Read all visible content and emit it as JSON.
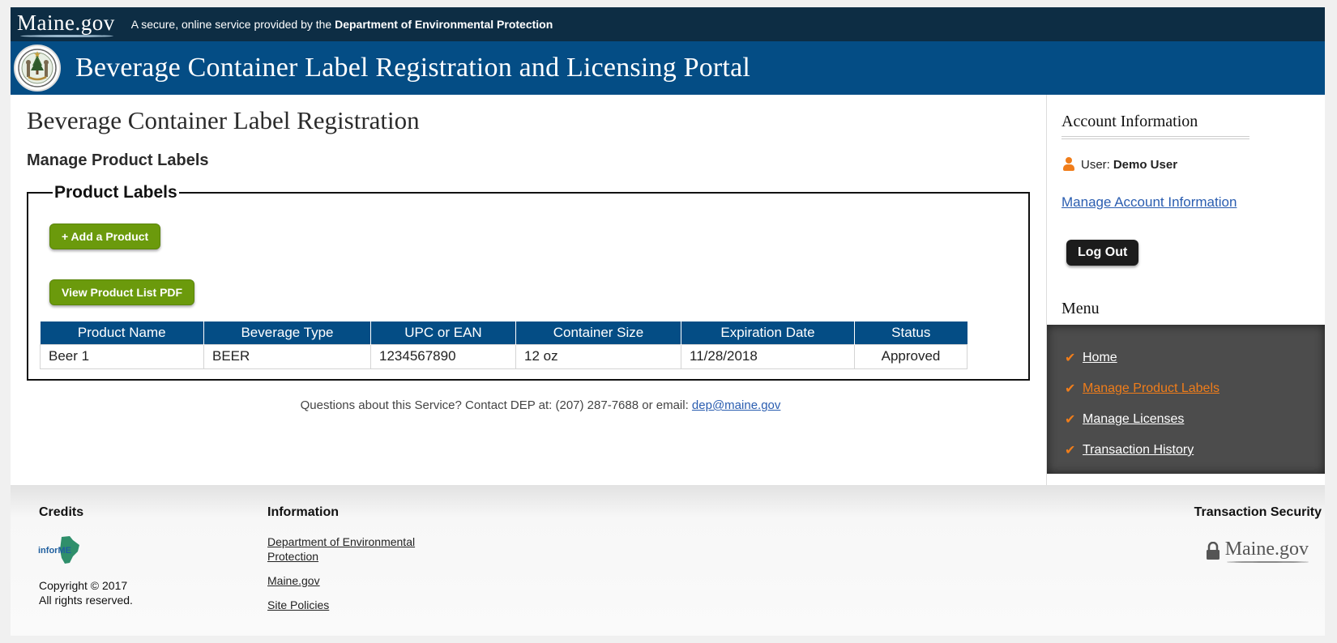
{
  "header": {
    "logo_text": "Maine.gov",
    "tagline_prefix": "A secure, online service provided by the",
    "tagline_agency": "Department of Environmental Protection",
    "portal_title": "Beverage Container Label Registration and Licensing Portal"
  },
  "main": {
    "page_title": "Beverage Container Label Registration",
    "section_title": "Manage Product Labels",
    "fieldset_legend": "Product Labels",
    "add_product_label": "+ Add a Product",
    "view_pdf_label": "View Product List PDF",
    "table": {
      "columns": [
        "Product Name",
        "Beverage Type",
        "UPC or EAN",
        "Container Size",
        "Expiration Date",
        "Status"
      ],
      "rows": [
        [
          "Beer 1",
          "BEER",
          "1234567890",
          "12 oz",
          "11/28/2018",
          "Approved"
        ]
      ]
    },
    "contact_text": "Questions about this Service? Contact DEP at: (207) 287-7688 or email:",
    "contact_email": "dep@maine.gov"
  },
  "sidebar": {
    "account_title": "Account Information",
    "user_prefix": "User:",
    "user_name": "Demo User",
    "manage_account_label": "Manage Account Information",
    "logout_label": "Log Out",
    "menu_title": "Menu",
    "menu_items": [
      {
        "label": "Home",
        "active": false
      },
      {
        "label": "Manage Product Labels",
        "active": true
      },
      {
        "label": "Manage Licenses",
        "active": false
      },
      {
        "label": "Transaction History",
        "active": false
      }
    ]
  },
  "footer": {
    "credits_title": "Credits",
    "informe_logo_text": "inforME",
    "copyright_line1": "Copyright © 2017",
    "copyright_line2": "All rights reserved.",
    "information_title": "Information",
    "links": [
      "Department of Environmental Protection",
      "Maine.gov",
      "Site Policies"
    ],
    "security_title": "Transaction Security",
    "security_logo_text": "Maine.gov"
  },
  "colors": {
    "topbar": "#0d2d44",
    "banner": "#044d85",
    "button_green": "#6b9a0c",
    "accent_orange": "#f07d1a",
    "menu_bg": "#4c4c4c"
  },
  "icons": [
    "state-seal-icon",
    "user-icon",
    "check-icon",
    "lock-icon",
    "informe-logo"
  ]
}
